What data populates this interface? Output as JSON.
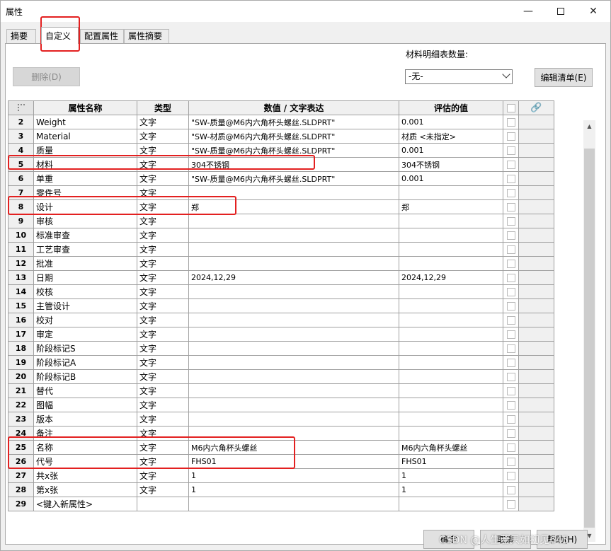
{
  "window": {
    "title": "属性"
  },
  "tabs": [
    {
      "label": "摘要",
      "active": false
    },
    {
      "label": "自定义",
      "active": true
    },
    {
      "label": "配置属性",
      "active": false
    },
    {
      "label": "属性摘要",
      "active": false
    }
  ],
  "toolbar": {
    "delete_label": "删除(D)",
    "qty_label": "材料明细表数量:",
    "qty_value": "-无-",
    "edit_list_label": "编辑清单(E)"
  },
  "grid": {
    "headers": {
      "name": "属性名称",
      "type": "类型",
      "value": "数值 / 文字表达",
      "eval": "评估的值"
    },
    "rows": [
      {
        "num": "2",
        "name": "Weight",
        "type": "文字",
        "value": "\"SW-质量@M6内六角杯头螺丝.SLDPRT\"",
        "eval": "0.001"
      },
      {
        "num": "3",
        "name": "Material",
        "type": "文字",
        "value": "\"SW-材质@M6内六角杯头螺丝.SLDPRT\"",
        "eval": "材质 <未指定>"
      },
      {
        "num": "4",
        "name": "质量",
        "type": "文字",
        "value": "\"SW-质量@M6内六角杯头螺丝.SLDPRT\"",
        "eval": "0.001"
      },
      {
        "num": "5",
        "name": "材料",
        "type": "文字",
        "value": "304不锈钢",
        "eval": "304不锈钢"
      },
      {
        "num": "6",
        "name": "单重",
        "type": "文字",
        "value": "\"SW-质量@M6内六角杯头螺丝.SLDPRT\"",
        "eval": "0.001"
      },
      {
        "num": "7",
        "name": "零件号",
        "type": "文字",
        "value": "",
        "eval": ""
      },
      {
        "num": "8",
        "name": "设计",
        "type": "文字",
        "value": "  郑",
        "eval": "  郑"
      },
      {
        "num": "9",
        "name": "审核",
        "type": "文字",
        "value": "",
        "eval": ""
      },
      {
        "num": "10",
        "name": "标准审查",
        "type": "文字",
        "value": "",
        "eval": ""
      },
      {
        "num": "11",
        "name": "工艺审查",
        "type": "文字",
        "value": "",
        "eval": ""
      },
      {
        "num": "12",
        "name": "批准",
        "type": "文字",
        "value": "",
        "eval": ""
      },
      {
        "num": "13",
        "name": "日期",
        "type": "文字",
        "value": "2024,12,29",
        "eval": "2024,12,29"
      },
      {
        "num": "14",
        "name": "校核",
        "type": "文字",
        "value": "",
        "eval": ""
      },
      {
        "num": "15",
        "name": "主管设计",
        "type": "文字",
        "value": "",
        "eval": ""
      },
      {
        "num": "16",
        "name": "校对",
        "type": "文字",
        "value": "",
        "eval": ""
      },
      {
        "num": "17",
        "name": "审定",
        "type": "文字",
        "value": "",
        "eval": ""
      },
      {
        "num": "18",
        "name": "阶段标记S",
        "type": "文字",
        "value": "",
        "eval": ""
      },
      {
        "num": "19",
        "name": "阶段标记A",
        "type": "文字",
        "value": "",
        "eval": ""
      },
      {
        "num": "20",
        "name": "阶段标记B",
        "type": "文字",
        "value": "",
        "eval": ""
      },
      {
        "num": "21",
        "name": "替代",
        "type": "文字",
        "value": "",
        "eval": ""
      },
      {
        "num": "22",
        "name": "图幅",
        "type": "文字",
        "value": "",
        "eval": ""
      },
      {
        "num": "23",
        "name": "版本",
        "type": "文字",
        "value": "",
        "eval": ""
      },
      {
        "num": "24",
        "name": "备注",
        "type": "文字",
        "value": "",
        "eval": ""
      },
      {
        "num": "25",
        "name": "名称",
        "type": "文字",
        "value": "M6内六角杯头螺丝",
        "eval": "M6内六角杯头螺丝"
      },
      {
        "num": "26",
        "name": "代号",
        "type": "文字",
        "value": "FHS01",
        "eval": "FHS01"
      },
      {
        "num": "27",
        "name": "共x张",
        "type": "文字",
        "value": "1",
        "eval": "1"
      },
      {
        "num": "28",
        "name": "第x张",
        "type": "文字",
        "value": "1",
        "eval": "1"
      },
      {
        "num": "29",
        "name": "<键入新属性>",
        "type": "",
        "value": "",
        "eval": ""
      }
    ]
  },
  "footer": {
    "ok_label": "确定",
    "cancel_label": "取消",
    "help_label": "帮助(H)"
  },
  "watermark": "CSDN @人生若只如初见645",
  "colors": {
    "highlight": "#e32020",
    "header_bg": "#f0f0f0",
    "window_bg": "#f0f0f0"
  }
}
